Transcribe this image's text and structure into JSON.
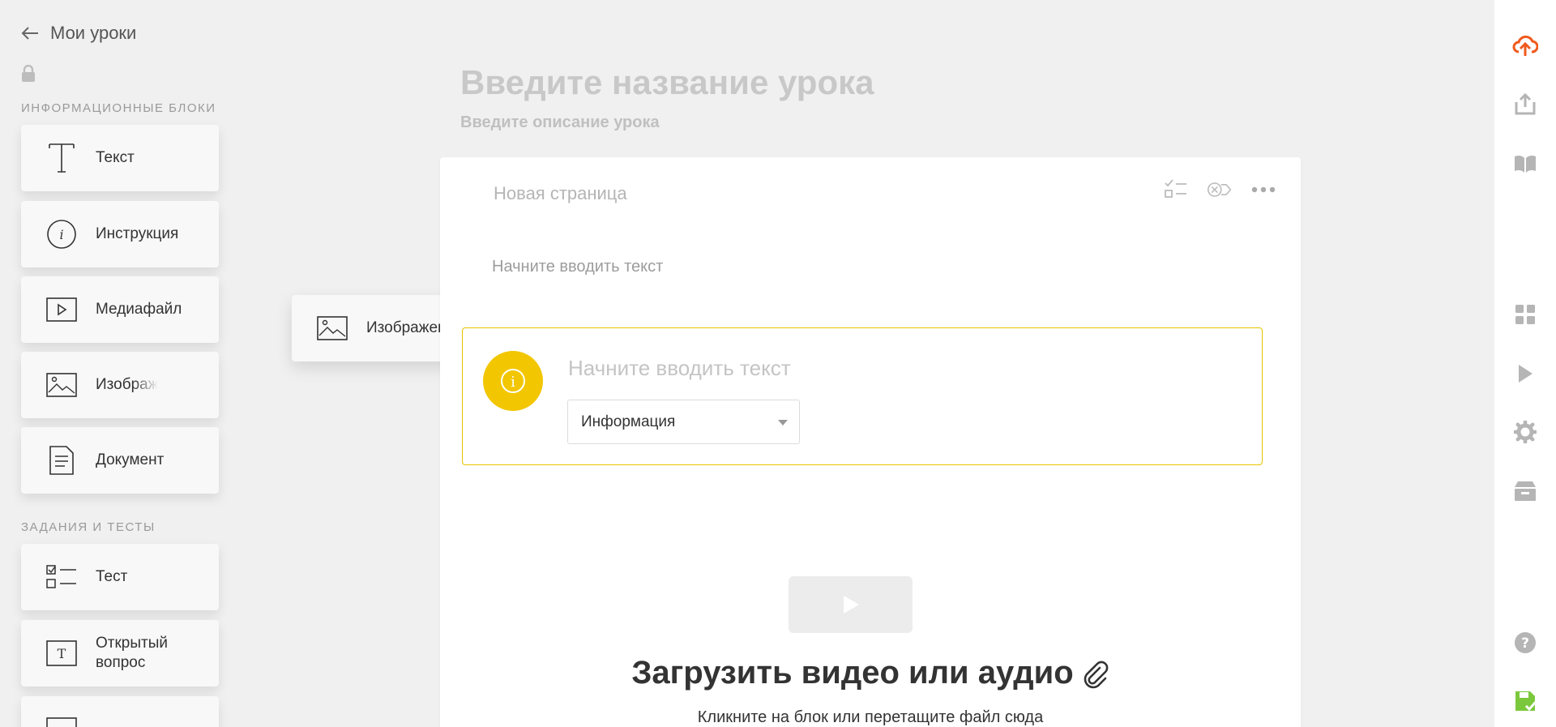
{
  "header": {
    "back_label": "Мои уроки"
  },
  "sidebar": {
    "info_section_title": "ИНФОРМАЦИОННЫЕ БЛОКИ",
    "info_blocks": [
      {
        "label": "Текст",
        "icon": "text-icon"
      },
      {
        "label": "Инструкция",
        "icon": "info-icon"
      },
      {
        "label": "Медиафайл",
        "icon": "media-icon"
      },
      {
        "label": "Изображ",
        "icon": "image-icon"
      },
      {
        "label": "Документ",
        "icon": "document-icon"
      }
    ],
    "tasks_section_title": "ЗАДАНИЯ И ТЕСТЫ",
    "task_blocks": [
      {
        "label": "Тест",
        "icon": "test-icon"
      },
      {
        "label": "Открытый вопрос",
        "icon": "open-question-icon"
      }
    ]
  },
  "drag_ghost": {
    "label": "Изображение",
    "icon": "image-icon"
  },
  "lesson": {
    "title_placeholder": "Введите название урока",
    "description_placeholder": "Введите описание урока"
  },
  "page": {
    "name": "Новая страница",
    "text_placeholder": "Начните вводить текст",
    "info_block": {
      "text_placeholder": "Начните вводить текст",
      "type_selected": "Информация",
      "accent_color": "#f2c600"
    },
    "media_block": {
      "title": "Загрузить видео или аудио",
      "hint": "Кликните на блок или перетащите файл сюда"
    }
  },
  "colors": {
    "upload_accent": "#f05a1e",
    "save_accent": "#7bc83c"
  }
}
